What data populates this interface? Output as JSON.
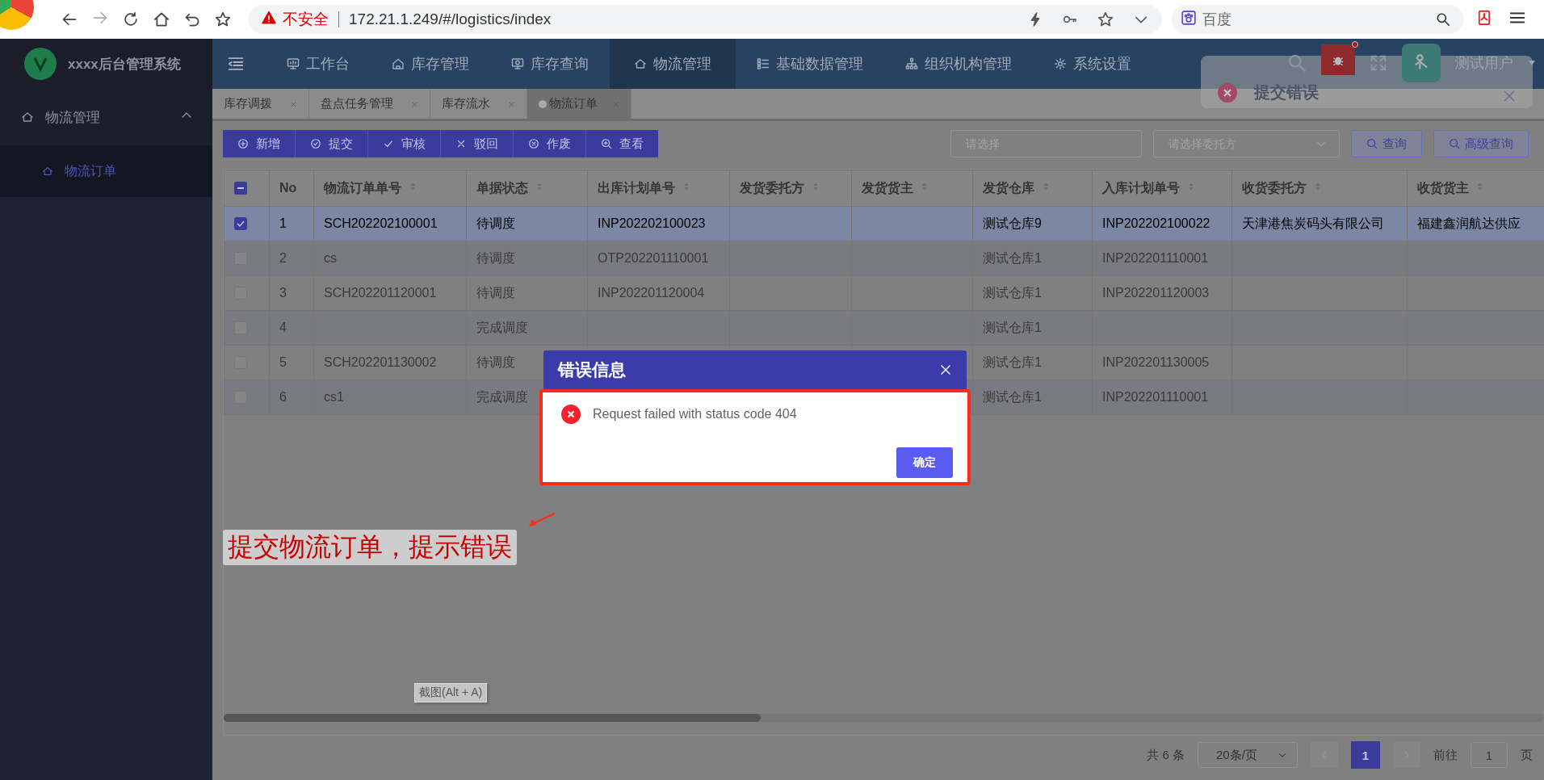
{
  "browser": {
    "security_label": "不安全",
    "url": "172.21.1.249/#/logistics/index",
    "search_placeholder": "百度"
  },
  "app": {
    "title": "xxxx后台管理系统"
  },
  "top_nav": [
    {
      "label": "工作台",
      "selected": false
    },
    {
      "label": "库存管理",
      "selected": false
    },
    {
      "label": "库存查询",
      "selected": false
    },
    {
      "label": "物流管理",
      "selected": true
    },
    {
      "label": "基础数据管理",
      "selected": false
    },
    {
      "label": "组织机构管理",
      "selected": false
    },
    {
      "label": "系统设置",
      "selected": false
    }
  ],
  "user": {
    "name": "测试用户"
  },
  "sidebar": {
    "label": "物流管理",
    "expanded": true,
    "children": [
      {
        "label": "物流订单",
        "selected": true
      }
    ]
  },
  "tabs": [
    {
      "label": "库存调拨",
      "selected": false
    },
    {
      "label": "盘点任务管理",
      "selected": false
    },
    {
      "label": "库存流水",
      "selected": false
    },
    {
      "label": "物流订单",
      "selected": true
    }
  ],
  "toolbar": {
    "buttons": [
      "新增",
      "提交",
      "审核",
      "驳回",
      "作废",
      "查看"
    ],
    "filter_placeholder": "请选择",
    "consignor_placeholder": "请选择委托方",
    "query_button": "查询",
    "advanced_query_button": "高级查询"
  },
  "table": {
    "select_all": {
      "checked": false,
      "indeterminate": true
    },
    "columns": [
      "No",
      "物流订单单号",
      "单据状态",
      "出库计划单号",
      "发货委托方",
      "发货货主",
      "发货仓库",
      "入库计划单号",
      "收货委托方",
      "收货货主"
    ],
    "rows": [
      {
        "selected": true,
        "cells": [
          "1",
          "SCH202202100001",
          "待调度",
          "INP202202100023",
          "",
          "",
          "测试仓库9",
          "INP202202100022",
          "天津港焦炭码头有限公司",
          "福建鑫润航达供应"
        ]
      },
      {
        "selected": false,
        "cells": [
          "2",
          "cs",
          "待调度",
          "OTP202201110001",
          "",
          "",
          "测试仓库1",
          "INP202201110001",
          "",
          ""
        ]
      },
      {
        "selected": false,
        "cells": [
          "3",
          "SCH202201120001",
          "待调度",
          "INP202201120004",
          "",
          "",
          "测试仓库1",
          "INP202201120003",
          "",
          ""
        ]
      },
      {
        "selected": false,
        "cells": [
          "4",
          "",
          "完成调度",
          "",
          "",
          "",
          "测试仓库1",
          "",
          "",
          ""
        ]
      },
      {
        "selected": false,
        "cells": [
          "5",
          "SCH202201130002",
          "待调度",
          "",
          "",
          "",
          "测试仓库1",
          "INP202201130005",
          "",
          ""
        ]
      },
      {
        "selected": false,
        "cells": [
          "6",
          "cs1",
          "完成调度",
          "",
          "",
          "",
          "测试仓库1",
          "INP202201110001",
          "",
          ""
        ]
      }
    ]
  },
  "pagination": {
    "total": "共 6 条",
    "page_size": "20条/页",
    "pages": [
      {
        "label": "1",
        "selected": true
      }
    ],
    "goto_label": "前往",
    "goto_value": "1",
    "page_unit": "页"
  },
  "notification": {
    "title": "提交错误"
  },
  "dialog": {
    "title": "错误信息",
    "message": "Request failed with status code 404",
    "confirm_button": "确定"
  },
  "annotation": {
    "text": "提交物流订单，提示错误"
  },
  "tooltip": {
    "text": "截图(Alt + A)"
  }
}
